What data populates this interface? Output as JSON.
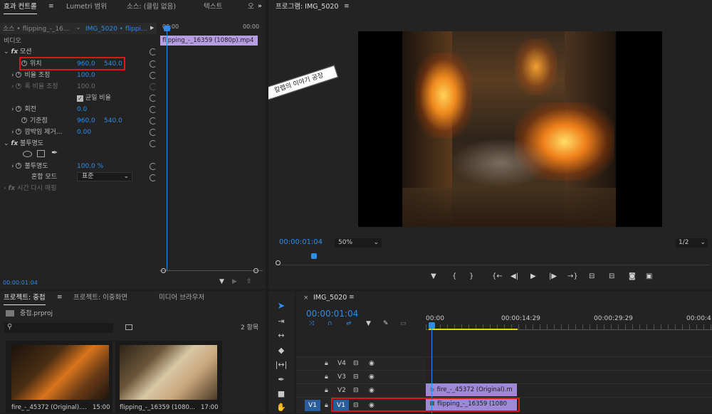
{
  "effect_controls": {
    "tabs": [
      "효과 컨트롤",
      "Lumetri 범위",
      "소스: (클립 없음)",
      "텍스트",
      "오"
    ],
    "source_label": "소스 • flipping_-_16...",
    "seq_label": "IMG_5020 • flippi...",
    "tc_start": "00:00",
    "tc_end": "00:00",
    "clip_name": "flipping_-_16359 (1080p).mp4",
    "video_header": "비디오",
    "motion": "모션",
    "position": {
      "label": "위치",
      "x": "960.0",
      "y": "540.0"
    },
    "scale": {
      "label": "비율 조정",
      "value": "100.0"
    },
    "scale_width": {
      "label": "폭 비율 조정",
      "value": "100.0"
    },
    "uniform_scale": "균일 비율",
    "rotation": {
      "label": "회전",
      "value": "0.0"
    },
    "anchor": {
      "label": "기준점",
      "x": "960.0",
      "y": "540.0"
    },
    "antiflicker": {
      "label": "깜박임 제거...",
      "value": "0.00"
    },
    "opacity_header": "불투명도",
    "opacity": {
      "label": "불투명도",
      "value": "100.0 %"
    },
    "blend_mode": {
      "label": "혼합 모드",
      "value": "표준"
    },
    "time_remap": "시간 다시 매핑",
    "timecode": "00:00:01:04"
  },
  "program": {
    "title": "프로그램: IMG_5020",
    "timecode": "00:00:01:04",
    "zoom": "50%",
    "quality": "1/2",
    "watermark": "칼렙의 이야기 공장"
  },
  "project": {
    "tabs": [
      "프로젝트: 중첩",
      "프로젝트: 이중화면",
      "미디어 브라우저"
    ],
    "file": "중첩.prproj",
    "count": "2 항목",
    "items": [
      {
        "name": "fire_-_45372 (Original)....",
        "duration": "15:00"
      },
      {
        "name": "flipping_-_16359 (1080...",
        "duration": "17:00"
      }
    ]
  },
  "timeline": {
    "sequence": "IMG_5020",
    "timecode": "00:00:01:04",
    "ruler": [
      "00:00",
      "00:00:14:29",
      "00:00:29:29",
      "00:00:4"
    ],
    "tracks": [
      "V4",
      "V3",
      "V2",
      "V1"
    ],
    "source_patch": "V1",
    "clips": {
      "v2": "fire_-_45372 (Original).m",
      "v1": "flipping_-_16359 (1080"
    }
  },
  "colors": {
    "accent": "#2d8ceb",
    "highlight": "#e0151c",
    "clip": "#9e88d8"
  }
}
